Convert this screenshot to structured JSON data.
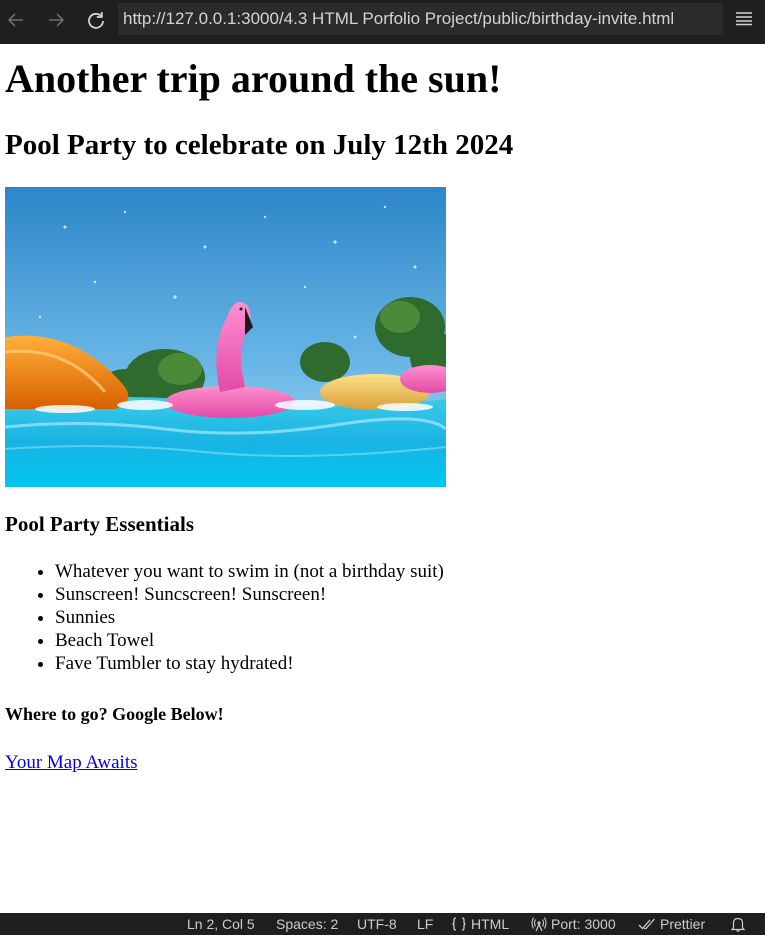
{
  "browser": {
    "url": "http://127.0.0.1:3000/4.3 HTML Porfolio Project/public/birthday-invite.html",
    "back_icon": "arrow-left-icon",
    "forward_icon": "arrow-right-icon",
    "reload_icon": "reload-icon",
    "menu_icon": "hamburger-menu-icon"
  },
  "page": {
    "heading": "Another trip around the sun!",
    "subheading": "Pool Party to celebrate on July 12th 2024",
    "essentials_heading": "Pool Party Essentials",
    "essentials": [
      "Whatever you want to swim in (not a birthday suit)",
      "Sunscreen! Suncscreen! Sunscreen!",
      "Sunnies",
      "Beach Towel",
      "Fave Tumbler to stay hydrated!"
    ],
    "where_heading": "Where to go? Google Below!",
    "map_link": "Your Map Awaits",
    "link_color": "#0000ee"
  },
  "statusbar": {
    "position": "Ln 2, Col 5",
    "spaces": "Spaces: 2",
    "encoding": "UTF-8",
    "eol": "LF",
    "language": "HTML",
    "port": "Port: 3000",
    "formatter": "Prettier",
    "bell_icon": "bell-icon"
  },
  "colors": {
    "chrome_bg": "#1f1f1f",
    "address_bg": "#2b2b2b",
    "chrome_text": "#d4d4d4"
  }
}
